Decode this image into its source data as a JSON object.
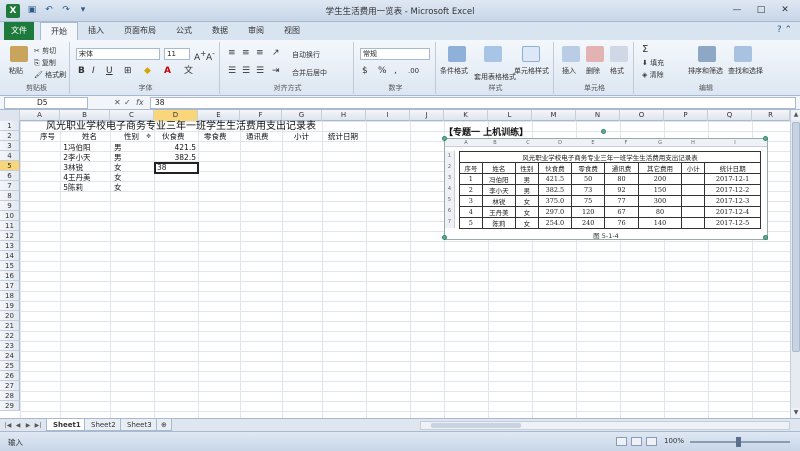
{
  "window": {
    "title": "学生生活费用一览表 - Microsoft Excel",
    "app_icon": "X",
    "controls": [
      "—",
      "□",
      "✕"
    ]
  },
  "ribbon_tabs": {
    "file": "文件",
    "tabs": [
      "开始",
      "插入",
      "页面布局",
      "公式",
      "数据",
      "审阅",
      "视图"
    ],
    "active": "开始"
  },
  "ribbon": {
    "clipboard": {
      "paste": "粘贴",
      "cut": "剪切",
      "copy": "复制",
      "format_painter": "格式刷",
      "label": "剪贴板"
    },
    "font": {
      "name": "宋体",
      "size": "11",
      "label": "字体",
      "bold": "B",
      "italic": "I",
      "underline": "U"
    },
    "alignment": {
      "wrap": "自动换行",
      "merge": "合并后居中",
      "label": "对齐方式"
    },
    "number": {
      "format": "常规",
      "label": "数字"
    },
    "styles": {
      "conditional": "条件格式",
      "table": "套用表格格式",
      "cell_styles": "单元格样式",
      "label": "样式"
    },
    "cells": {
      "insert": "插入",
      "delete": "删除",
      "format": "格式",
      "label": "单元格"
    },
    "editing": {
      "sum": "Σ",
      "fill": "填充",
      "clear": "清除",
      "sort": "排序和筛选",
      "find": "查找和选择",
      "label": "编辑"
    }
  },
  "formula_bar": {
    "name_box": "D5",
    "fx": "fx",
    "cancel": "✕",
    "confirm": "✓",
    "content": "38"
  },
  "columns": [
    "A",
    "B",
    "C",
    "D",
    "E",
    "F",
    "G",
    "H",
    "I",
    "J",
    "K",
    "L",
    "M",
    "N",
    "O",
    "P",
    "Q",
    "R"
  ],
  "rows": [
    "1",
    "2",
    "3",
    "4",
    "5",
    "6",
    "7",
    "8",
    "9",
    "10",
    "11",
    "12",
    "13",
    "14",
    "15",
    "16",
    "17",
    "18",
    "19",
    "20",
    "21",
    "22",
    "23",
    "24",
    "25",
    "26",
    "27",
    "28",
    "29"
  ],
  "sheet": {
    "title": "风光职业学校电子商务专业三年一班学生生活费用支出记录表",
    "headers": [
      "序号",
      "姓名",
      "性别",
      "伙食费",
      "零食费",
      "通讯费",
      "小计",
      "统计日期"
    ],
    "data": [
      {
        "no": "1",
        "name": "冯伯阳",
        "gender": "男",
        "food": "421.5"
      },
      {
        "no": "2",
        "name": "李小天",
        "gender": "男",
        "food": "382.5"
      },
      {
        "no": "3",
        "name": "林锐",
        "gender": "女",
        "food": "38"
      },
      {
        "no": "4",
        "name": "王丹美",
        "gender": "女",
        "food": ""
      },
      {
        "no": "5",
        "name": "陈莉",
        "gender": "女",
        "food": ""
      }
    ]
  },
  "embedded": {
    "heading": "【专题一 上机训练】",
    "cols": [
      "A",
      "B",
      "C",
      "D",
      "E",
      "F",
      "G",
      "H",
      "I"
    ],
    "title": "风光职业学校电子商务专业三年一班学生生活费用支出记录表",
    "headers": [
      "序号",
      "姓名",
      "性别",
      "伙食费",
      "零食费",
      "通讯费",
      "其它费用",
      "小计",
      "统计日期"
    ],
    "rows": [
      [
        "1",
        "冯伯阳",
        "男",
        "421.5",
        "50",
        "80",
        "200",
        "",
        "2017-12-1"
      ],
      [
        "2",
        "李小天",
        "男",
        "382.5",
        "73",
        "92",
        "150",
        "",
        "2017-12-2"
      ],
      [
        "3",
        "林锐",
        "女",
        "375.0",
        "75",
        "77",
        "300",
        "",
        "2017-12-3"
      ],
      [
        "4",
        "王丹美",
        "女",
        "297.0",
        "120",
        "67",
        "80",
        "",
        "2017-12-4"
      ],
      [
        "5",
        "陈莉",
        "女",
        "254.0",
        "240",
        "76",
        "140",
        "",
        "2017-12-5"
      ]
    ],
    "caption": "图 5-1-4"
  },
  "sheet_tabs": [
    "Sheet1",
    "Sheet2",
    "Sheet3"
  ],
  "status": {
    "mode": "输入",
    "zoom": "100%"
  }
}
